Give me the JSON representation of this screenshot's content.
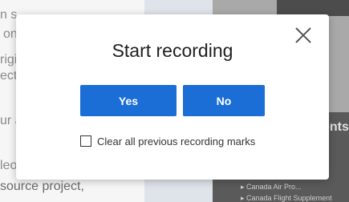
{
  "background": {
    "left_lines": [
      "n s",
      "on",
      "rigi",
      "ecto",
      "ur a",
      "leo",
      "source project,"
    ],
    "right_lines": [
      "▸ Canada Air Pro...",
      "▸ Canada Flight Supplement"
    ],
    "right_heading": "ents"
  },
  "dialog": {
    "title": "Start recording",
    "yes_label": "Yes",
    "no_label": "No",
    "checkbox_label": "Clear all previous recording marks",
    "checkbox_checked": false,
    "close_icon": "close-icon"
  },
  "colors": {
    "primary_button": "#1a6ed6",
    "dialog_bg": "#ffffff"
  }
}
